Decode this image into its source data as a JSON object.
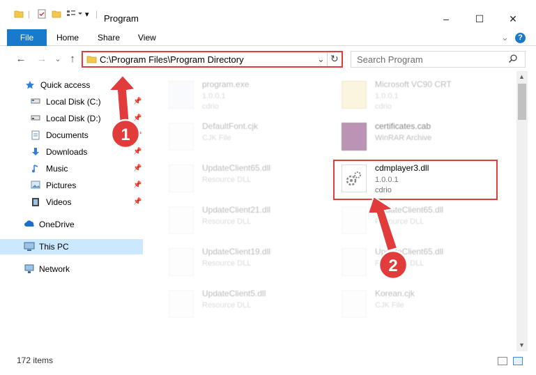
{
  "window": {
    "title": "Program",
    "minimize": "–",
    "maximize": "☐",
    "close": "✕"
  },
  "ribbon": {
    "tabs": [
      "File",
      "Home",
      "Share",
      "View"
    ],
    "help": "?",
    "expand": "⌄"
  },
  "address": {
    "path": "C:\\Program Files\\Program Directory",
    "refresh": "↻",
    "dropdown": "⌄"
  },
  "search": {
    "placeholder": "Search Program"
  },
  "nav": {
    "back": "←",
    "forward": "→",
    "recent": "⌄",
    "up": "↑",
    "items": [
      {
        "label": "Quick access",
        "icon": "star-icon",
        "pinned": false
      },
      {
        "label": "Local Disk (C:)",
        "icon": "drive-icon",
        "pinned": true
      },
      {
        "label": "Local Disk (D:)",
        "icon": "drive-icon",
        "pinned": true
      },
      {
        "label": "Documents",
        "icon": "documents-icon",
        "pinned": true
      },
      {
        "label": "Downloads",
        "icon": "downloads-icon",
        "pinned": true
      },
      {
        "label": "Music",
        "icon": "music-icon",
        "pinned": true
      },
      {
        "label": "Pictures",
        "icon": "pictures-icon",
        "pinned": true
      },
      {
        "label": "Videos",
        "icon": "videos-icon",
        "pinned": true
      },
      {
        "label": "OneDrive",
        "icon": "onedrive-icon",
        "pinned": false
      },
      {
        "label": "This PC",
        "icon": "pc-icon",
        "pinned": false
      },
      {
        "label": "Network",
        "icon": "network-icon",
        "pinned": false
      }
    ]
  },
  "files": [
    {
      "name": "program.exe",
      "line2": "1.0.0.1",
      "line3": "cdrio",
      "dim": true
    },
    {
      "name": "Microsoft VC90 CRT",
      "line2": "1.0.0.1",
      "line3": "cdrio",
      "dim": true
    },
    {
      "name": "DefaultFont.cjk",
      "line2": "CJK File",
      "line3": "",
      "dim": true
    },
    {
      "name": "certificates.cab",
      "line2": "WinRAR Archive",
      "line3": "",
      "dim": true
    },
    {
      "name": "UpdateClient65.dll",
      "line2": "Resource DLL",
      "line3": "",
      "dim": true
    },
    {
      "name": "cdmplayer3.dll",
      "line2": "1.0.0.1",
      "line3": "cdrio",
      "dim": false
    },
    {
      "name": "UpdateClient21.dll",
      "line2": "Resource DLL",
      "line3": "",
      "dim": true
    },
    {
      "name": "UpdateClient65.dll",
      "line2": "Resource DLL",
      "line3": "",
      "dim": true
    },
    {
      "name": "UpdateClient19.dll",
      "line2": "Resource DLL",
      "line3": "",
      "dim": true
    },
    {
      "name": "UpdateClient65.dll",
      "line2": "Resource DLL",
      "line3": "",
      "dim": true
    },
    {
      "name": "UpdateClient5.dll",
      "line2": "Resource DLL",
      "line3": "",
      "dim": true
    },
    {
      "name": "Korean.cjk",
      "line2": "CJK File",
      "line3": "",
      "dim": true
    }
  ],
  "status": {
    "count": "172 items"
  },
  "annotations": {
    "step1": "1",
    "step2": "2",
    "accent": "#e23b3b"
  }
}
